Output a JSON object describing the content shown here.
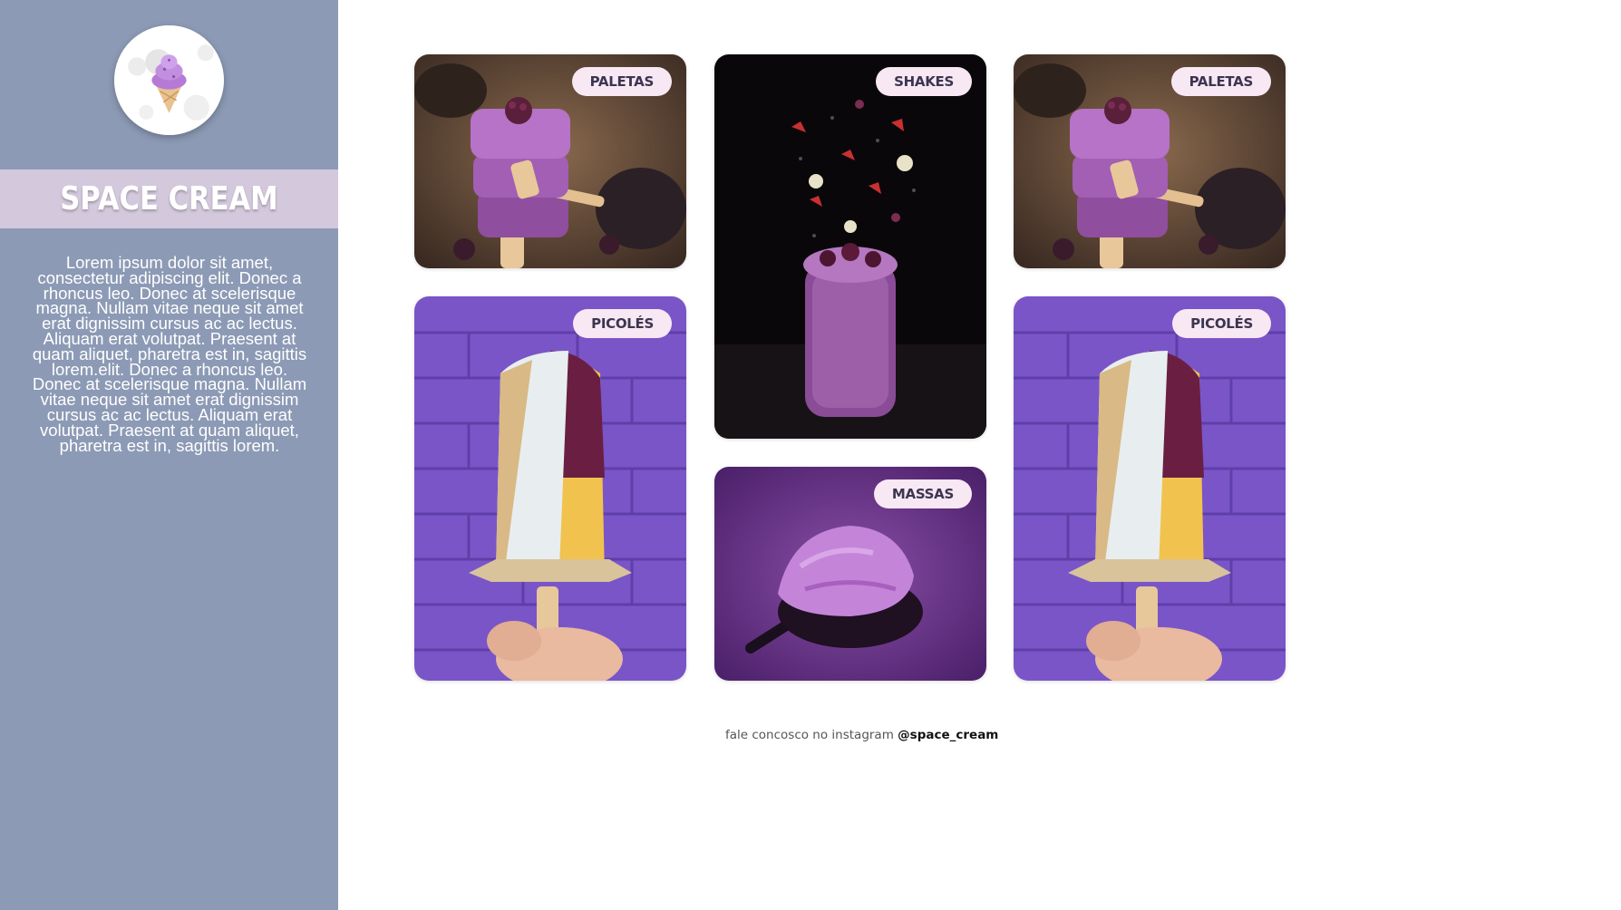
{
  "sidebar": {
    "logo_icon": "ice-cream-cone-icon",
    "brand": "SPACE CREAM",
    "about": "Lorem ipsum dolor sit amet, consectetur adipiscing elit. Donec a rhoncus leo. Donec at scelerisque magna. Nullam vitae neque sit amet erat dignissim cursus ac ac lectus. Aliquam erat volutpat. Praesent at quam aliquet, pharetra est in, sagittis lorem.elit. Donec a rhoncus leo. Donec at scelerisque magna. Nullam vitae neque sit amet erat dignissim cursus ac ac lectus. Aliquam erat volutpat. Praesent at quam aliquet, pharetra est in, sagittis lorem."
  },
  "gallery": {
    "cards": [
      {
        "label": "PALETAS"
      },
      {
        "label": "SHAKES"
      },
      {
        "label": "PALETAS"
      },
      {
        "label": "PICOLÉS"
      },
      {
        "label": "MASSAS"
      },
      {
        "label": "PICOLÉS"
      }
    ]
  },
  "footer": {
    "text": "fale concosco no instagram",
    "handle": "@space_cream"
  },
  "colors": {
    "sidebar": "#8c9ab5",
    "brand_band": "#d3c8dc",
    "tag_bg": "#f8e8f4",
    "tag_text": "#3b3550"
  }
}
